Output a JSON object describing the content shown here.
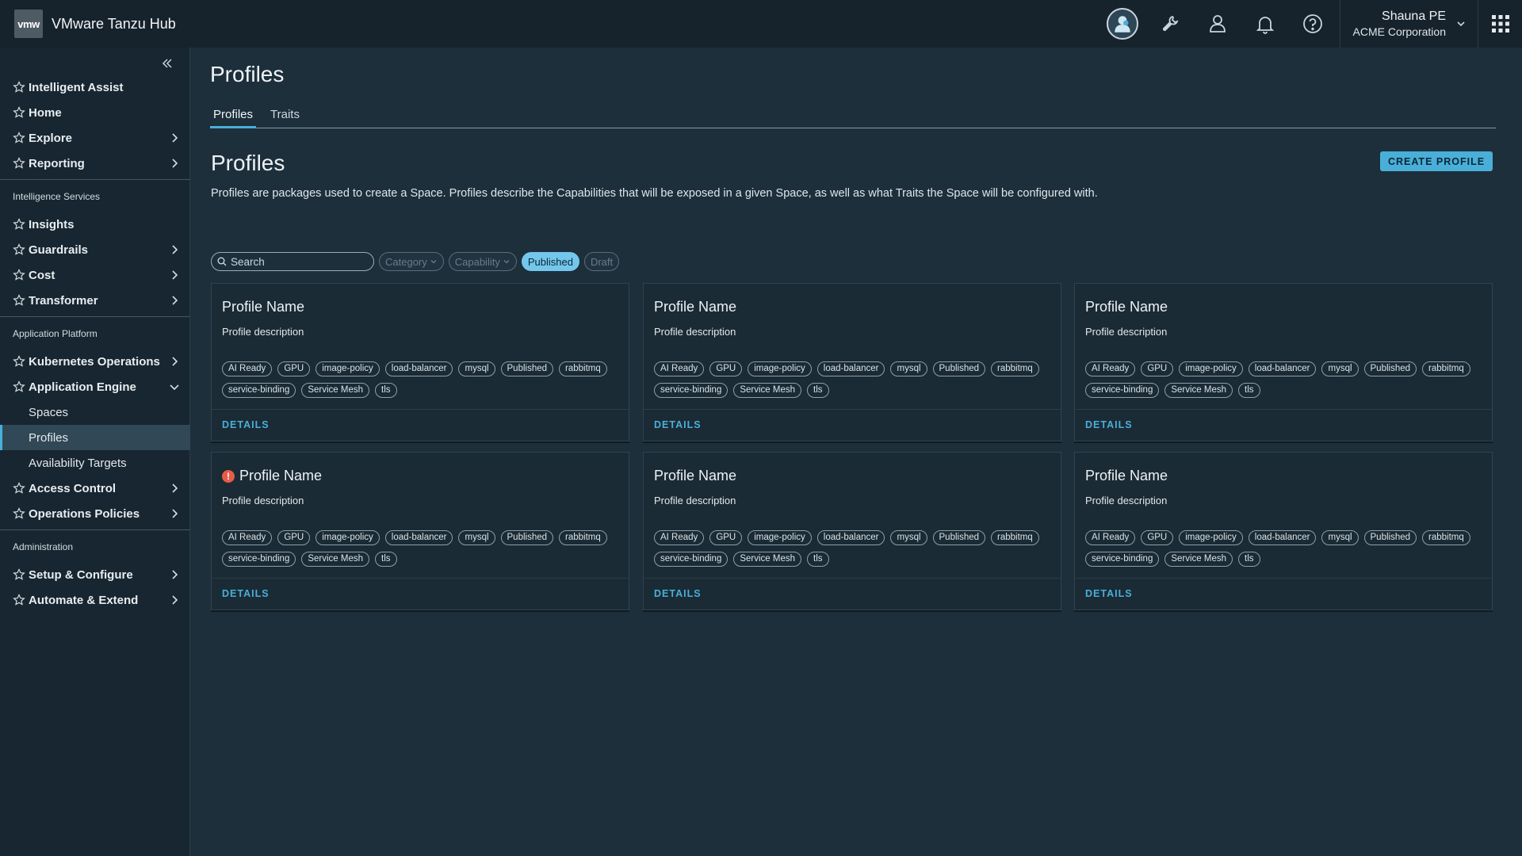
{
  "header": {
    "logo_text": "vmw",
    "app_title": "VMware Tanzu Hub",
    "user_name": "Shauna PE",
    "user_org": "ACME Corporation"
  },
  "sidebar": {
    "groups": [
      {
        "section": "",
        "items": [
          {
            "label": "Intelligent Assist",
            "chevron": false
          },
          {
            "label": "Home",
            "chevron": false
          },
          {
            "label": "Explore",
            "chevron": true
          },
          {
            "label": "Reporting",
            "chevron": true
          }
        ]
      },
      {
        "section": "Intelligence Services",
        "items": [
          {
            "label": "Insights",
            "chevron": false
          },
          {
            "label": "Guardrails",
            "chevron": true
          },
          {
            "label": "Cost",
            "chevron": true
          },
          {
            "label": "Transformer",
            "chevron": true
          }
        ]
      },
      {
        "section": "Application Platform",
        "items": [
          {
            "label": "Kubernetes Operations",
            "chevron": true
          },
          {
            "label": "Application Engine",
            "chevron": "open",
            "sub": [
              {
                "label": "Spaces",
                "active": false
              },
              {
                "label": "Profiles",
                "active": true
              },
              {
                "label": "Availability Targets",
                "active": false
              }
            ]
          },
          {
            "label": "Access Control",
            "chevron": true
          },
          {
            "label": "Operations Policies",
            "chevron": true
          }
        ]
      },
      {
        "section": "Administration",
        "items": [
          {
            "label": "Setup & Configure",
            "chevron": true
          },
          {
            "label": "Automate & Extend",
            "chevron": true
          }
        ]
      }
    ]
  },
  "main": {
    "page_title": "Profiles",
    "tabs": [
      {
        "label": "Profiles",
        "active": true
      },
      {
        "label": "Traits",
        "active": false
      }
    ],
    "section_title": "Profiles",
    "create_button": "CREATE PROFILE",
    "description": "Profiles are packages used to create a Space.  Profiles describe the Capabilities that will be exposed in a given Space, as well as what Traits the Space will be configured with.",
    "search_placeholder": "Search",
    "filters": [
      {
        "label": "Category",
        "dropdown": true,
        "selected": false
      },
      {
        "label": "Capability",
        "dropdown": true,
        "selected": false
      },
      {
        "label": "Published",
        "dropdown": false,
        "selected": true
      },
      {
        "label": "Draft",
        "dropdown": false,
        "selected": false
      }
    ],
    "details_label": "DETAILS",
    "cards": [
      {
        "title": "Profile Name",
        "description": "Profile description",
        "error": false
      },
      {
        "title": "Profile Name",
        "description": "Profile description",
        "error": false
      },
      {
        "title": "Profile Name",
        "description": "Profile description",
        "error": false
      },
      {
        "title": "Profile Name",
        "description": "Profile description",
        "error": true
      },
      {
        "title": "Profile Name",
        "description": "Profile description",
        "error": false
      },
      {
        "title": "Profile Name",
        "description": "Profile description",
        "error": false
      }
    ],
    "tags": [
      "AI Ready",
      "GPU",
      "image-policy",
      "load-balancer",
      "mysql",
      "Published",
      "rabbitmq",
      "service-binding",
      "Service Mesh",
      "tls"
    ],
    "error_icon_glyph": "!"
  },
  "colors": {
    "accent": "#49afd9",
    "header_bg": "#17232c",
    "sidebar_bg": "#172630",
    "main_bg": "#1d2f3b",
    "error": "#e85c47"
  },
  "icons": [
    "user-avatar-icon",
    "wrench-icon",
    "person-icon",
    "bell-icon",
    "help-icon",
    "chevron-down-icon",
    "apps-grid-icon",
    "collapse-icon",
    "star-icon",
    "chevron-right-icon",
    "search-icon",
    "error-icon"
  ]
}
